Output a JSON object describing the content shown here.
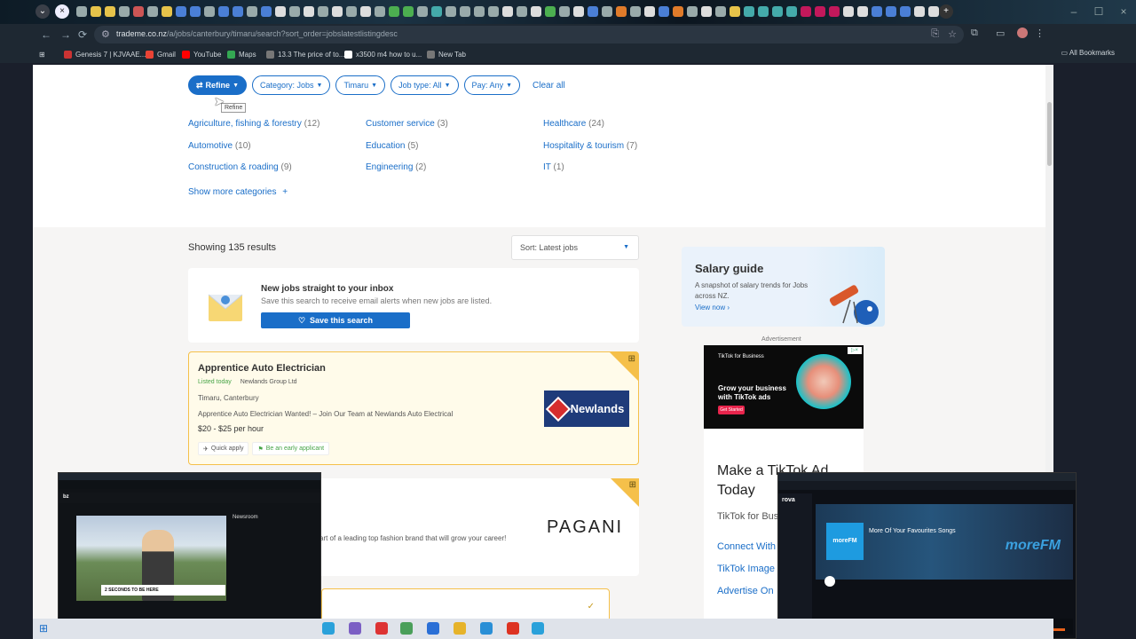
{
  "browser": {
    "url_host": "trademe.co.nz",
    "url_path": "/a/jobs/canterbury/timaru/search?sort_order=jobslatestlistingdesc",
    "bookmarks": [
      "Genesis 7 | KJVAAE...",
      "Gmail",
      "YouTube",
      "Maps",
      "13.3 The price of to...",
      "x3500 m4 how to u...",
      "New Tab"
    ],
    "all_bookmarks_label": "All Bookmarks"
  },
  "filters": {
    "refine_label": "Refine",
    "category_label": "Category: Jobs",
    "region_label": "Timaru",
    "jobtype_label": "Job type: All",
    "pay_label": "Pay: Any",
    "clear_label": "Clear all",
    "tooltip": "Refine"
  },
  "categories": [
    {
      "name": "Agriculture, fishing & forestry",
      "count": "(12)"
    },
    {
      "name": "Customer service",
      "count": "(3)"
    },
    {
      "name": "Healthcare",
      "count": "(24)"
    },
    {
      "name": "Automotive",
      "count": "(10)"
    },
    {
      "name": "Education",
      "count": "(5)"
    },
    {
      "name": "Hospitality & tourism",
      "count": "(7)"
    },
    {
      "name": "Construction & roading",
      "count": "(9)"
    },
    {
      "name": "Engineering",
      "count": "(2)"
    },
    {
      "name": "IT",
      "count": "(1)"
    }
  ],
  "show_more_categories": "Show more categories",
  "results": {
    "showing": "Showing 135 results",
    "sort_label": "Sort: Latest jobs"
  },
  "alert_card": {
    "title": "New jobs straight to your inbox",
    "subtitle": "Save this search to receive email alerts when new jobs are listed.",
    "button": "Save this search"
  },
  "job1": {
    "title": "Apprentice Auto Electrician",
    "listed": "Listed today",
    "company": "Newlands Group Ltd",
    "location": "Timaru, Canterbury",
    "description": "Apprentice Auto Electrician Wanted! – Join Our Team at Newlands Auto Electrical",
    "pay": "$20 - $25 per hour",
    "chip_quick": "Quick apply",
    "chip_early": "Be an early applicant",
    "logo_text": "Newlands"
  },
  "job2": {
    "description": "art of a leading top fashion brand that will grow your career!",
    "logo_text": "PAGANI"
  },
  "salary_guide": {
    "title": "Salary guide",
    "subtitle": "A snapshot of salary trends for Jobs across NZ.",
    "link": "View now"
  },
  "advert": {
    "label": "Advertisement",
    "brand": "TikTok for Business",
    "headline": "Grow your business with TikTok ads",
    "cta": "Get Started",
    "title": "Make a TikTok Ad Today",
    "subtitle": "TikTok for Bus",
    "links": [
      "Connect With",
      "TikTok Image",
      "Advertise On"
    ]
  },
  "overlay_left": {
    "site": "bz",
    "caption": "2 SECONDS TO BE HERE",
    "side_title": "Newsroom"
  },
  "overlay_right": {
    "app": "rova",
    "station": "More Of Your Favourites Songs",
    "brand": "moreFM",
    "logo": "moreFM"
  },
  "colors": {
    "accent": "#1a6ec8",
    "featured_border": "#f5c04a",
    "featured_bg": "#fffbea",
    "listed_green": "#47a447"
  }
}
